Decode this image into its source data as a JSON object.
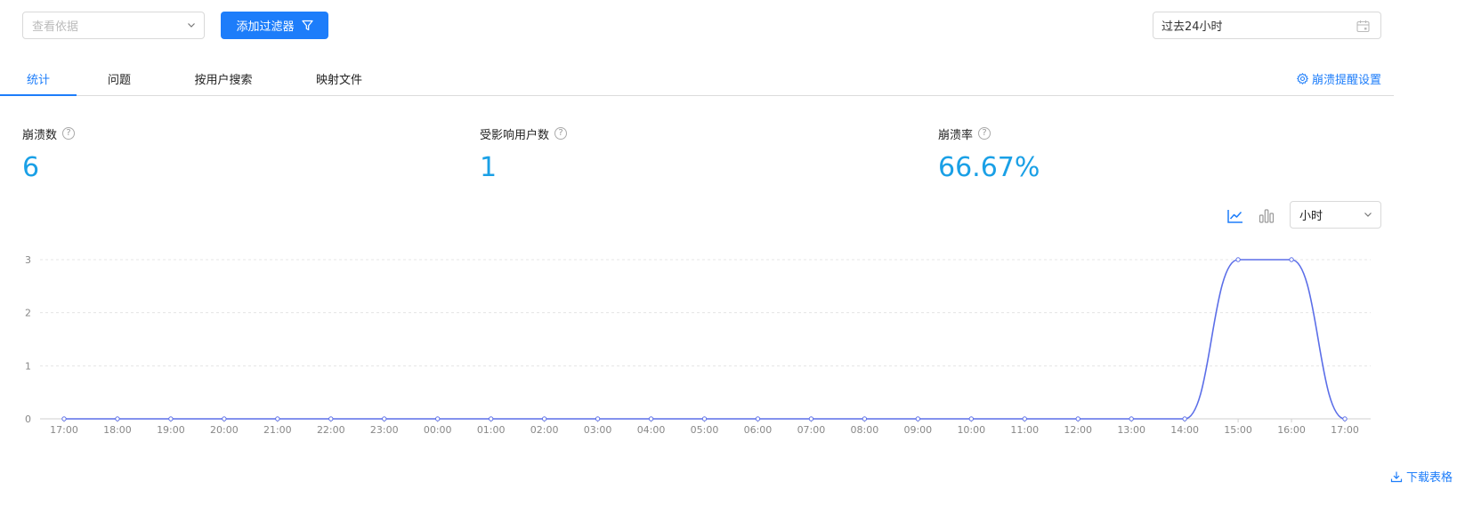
{
  "toolbar": {
    "view_placeholder": "查看依据",
    "add_filter_label": "添加过滤器",
    "date_range": "过去24小时"
  },
  "tabs": [
    {
      "label": "统计",
      "active": true
    },
    {
      "label": "问题",
      "active": false
    },
    {
      "label": "按用户搜索",
      "active": false
    },
    {
      "label": "映射文件",
      "active": false
    }
  ],
  "settings_label": "崩溃提醒设置",
  "metrics": [
    {
      "label": "崩溃数",
      "value": "6"
    },
    {
      "label": "受影响用户数",
      "value": "1"
    },
    {
      "label": "崩溃率",
      "value": "66.67%"
    }
  ],
  "chart_controls": {
    "granularity": "小时",
    "line_icon": "line-chart-icon",
    "bar_icon": "bar-chart-icon"
  },
  "download_label": "下载表格",
  "colors": {
    "accent": "#1d7dfa",
    "metric_value": "#1aa0e6",
    "series_line": "#5b6ee8"
  },
  "chart_data": {
    "type": "line",
    "x": [
      "17:00",
      "18:00",
      "19:00",
      "20:00",
      "21:00",
      "22:00",
      "23:00",
      "00:00",
      "01:00",
      "02:00",
      "03:00",
      "04:00",
      "05:00",
      "06:00",
      "07:00",
      "08:00",
      "09:00",
      "10:00",
      "11:00",
      "12:00",
      "13:00",
      "14:00",
      "15:00",
      "16:00",
      "17:00"
    ],
    "series": [
      {
        "values": [
          0,
          0,
          0,
          0,
          0,
          0,
          0,
          0,
          0,
          0,
          0,
          0,
          0,
          0,
          0,
          0,
          0,
          0,
          0,
          0,
          0,
          0,
          3,
          3,
          0
        ]
      }
    ],
    "yticks": [
      0,
      1,
      2,
      3
    ],
    "ylim": [
      0,
      3
    ],
    "grid": true,
    "smooth": true
  }
}
